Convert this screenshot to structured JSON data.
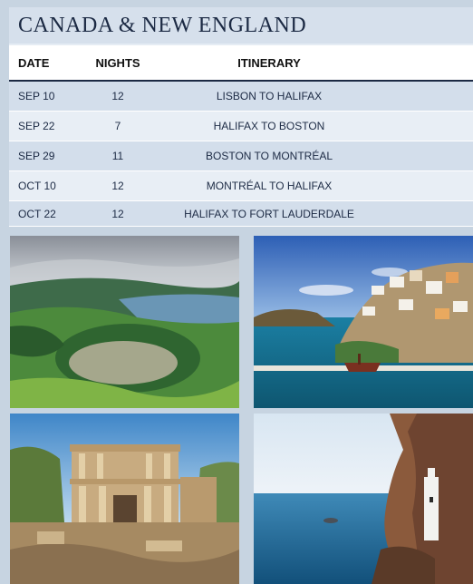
{
  "title": "CANADA & NEW ENGLAND",
  "table": {
    "headers": [
      "DATE",
      "NIGHTS",
      "ITINERARY"
    ],
    "rows": [
      {
        "date": "SEP 10",
        "nights": "12",
        "itinerary": "LISBON TO HALIFAX"
      },
      {
        "date": "SEP 22",
        "nights": "7",
        "itinerary": "HALIFAX TO BOSTON"
      },
      {
        "date": "SEP 29",
        "nights": "11",
        "itinerary": "BOSTON TO MONTRÉAL"
      },
      {
        "date": "OCT 10",
        "nights": "12",
        "itinerary": "MONTRÉAL TO HALIFAX"
      },
      {
        "date": "OCT 22",
        "nights": "12",
        "itinerary": "HALIFAX TO FORT LAUDERDALE"
      }
    ]
  },
  "photos": [
    "crater-lake-photo",
    "greek-harbor-photo",
    "ancient-library-ruins-photo",
    "cliff-monastery-photo"
  ]
}
